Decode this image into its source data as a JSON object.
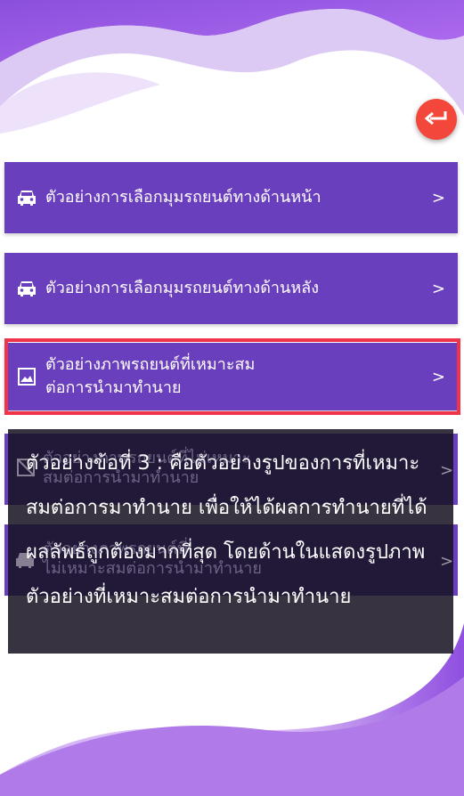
{
  "back_button": {
    "icon": "return-arrow-icon"
  },
  "menu": [
    {
      "label": "ตัวอย่างการเลือกมุมรถยนต์ทางด้านหน้า",
      "icon": "car-front-icon",
      "arrow": ">"
    },
    {
      "label": "ตัวอย่างการเลือกมุมรถยนต์ทางด้านหลัง",
      "icon": "car-front-icon",
      "arrow": ">"
    },
    {
      "label": "ตัวอย่างภาพรถยนต์ที่เหมาะสม\nต่อการนำมาทำนาย",
      "icon": "image-icon",
      "arrow": ">"
    },
    {
      "label": "ตัวอย่างภาพรถยนต์ที่ไม่เหมาะ\nสมต่อการนำมาทำนาย",
      "icon": "image-broken-icon",
      "arrow": ">"
    },
    {
      "label": "ตัวอย่างภาพรถยนต์ที่\nไม่เหมาะสมต่อการนำมาทำนาย",
      "icon": "car-icon",
      "arrow": ">"
    }
  ],
  "tooltip": {
    "text": "ตัวอย่างข้อที่ 3 : คือตัวอย่างรูปของการที่เหมาะสมต่อการมาทำนาย เพื่อให้ได้ผลการทำนายที่ได้ผลลัพธ์ถูกต้องมากที่สุด โดยด้านในแสดงรูปภาพตัวอย่างที่เหมาะสมต่อการนำมาทำนาย"
  },
  "colors": {
    "button": "#6a3fbe",
    "highlight": "#f0334a",
    "back": "#f4473b"
  }
}
